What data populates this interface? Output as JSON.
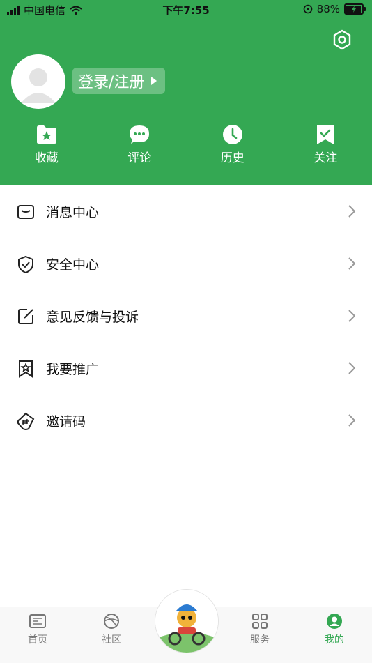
{
  "status_bar": {
    "carrier": "中国电信",
    "time": "下午7:55",
    "battery": "88%",
    "battery_level": 0.88
  },
  "profile": {
    "login_label": "登录/注册"
  },
  "quick_actions": [
    {
      "label": "收藏",
      "icon": "folder-star-icon"
    },
    {
      "label": "评论",
      "icon": "comment-bubble-icon"
    },
    {
      "label": "历史",
      "icon": "clock-icon"
    },
    {
      "label": "关注",
      "icon": "bookmark-check-icon"
    }
  ],
  "menu": [
    {
      "label": "消息中心",
      "icon": "mail-icon"
    },
    {
      "label": "安全中心",
      "icon": "shield-check-icon"
    },
    {
      "label": "意见反馈与投诉",
      "icon": "edit-icon"
    },
    {
      "label": "我要推广",
      "icon": "bookmark-star-icon"
    },
    {
      "label": "邀请码",
      "icon": "hash-tag-icon"
    }
  ],
  "tabbar": [
    {
      "label": "首页",
      "icon": "news-icon"
    },
    {
      "label": "社区",
      "icon": "globe-icon"
    },
    {
      "label": "",
      "icon": "mascot-badge"
    },
    {
      "label": "服务",
      "icon": "grid-icon"
    },
    {
      "label": "我的",
      "icon": "user-icon",
      "active": true
    }
  ],
  "colors": {
    "brand_green": "#34a853",
    "tab_inactive": "#777777"
  }
}
